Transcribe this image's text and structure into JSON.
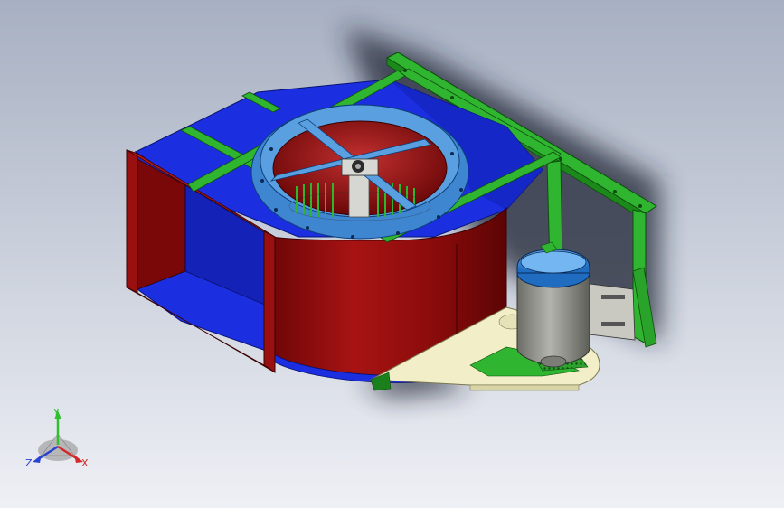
{
  "viewport": {
    "name": "cad-graphics-area",
    "background_top": "#a9b2c4",
    "background_bottom": "#eef0f5"
  },
  "model": {
    "name": "centrifugal-fan-assembly",
    "colors": {
      "housing_red": "#8e0c0c",
      "housing_red_light": "#c02525",
      "panel_blue": "#1c2fe0",
      "panel_blue_dark": "#0d1a9c",
      "ring_light_blue": "#4f95d8",
      "frame_green": "#2fb52f",
      "frame_green_dark": "#1b7f1b",
      "motor_gray": "#8a8a84",
      "motor_cap_blue": "#2f86dd",
      "base_cream": "#f2efc8",
      "shadow": "#1f2230"
    }
  },
  "triad": {
    "y_label": "Y",
    "x_label": "X",
    "z_label": "Z",
    "y_color": "#2fbf2f",
    "x_color": "#d22a2a",
    "z_color": "#2a43d2"
  }
}
